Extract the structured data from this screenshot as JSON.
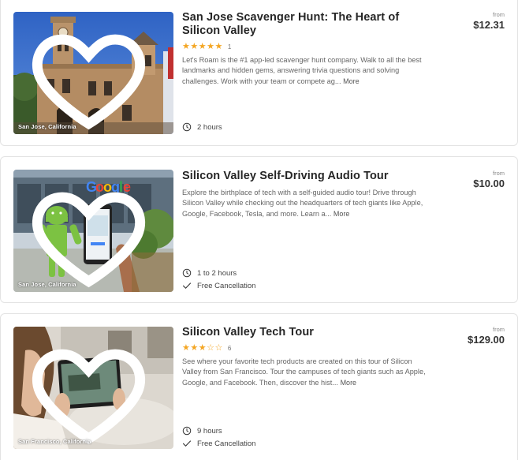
{
  "tours": [
    {
      "title": "San Jose Scavenger Hunt: The Heart of Silicon Valley",
      "location": "San Jose, California",
      "rating": 5,
      "review_count": "1",
      "description": "Let's Roam is the #1 app-led scavenger hunt company. Walk to all the best landmarks and hidden gems, answering trivia questions and solving challenges. Work with your team or compete ag...",
      "more_label": "More",
      "duration": "2 hours",
      "cancellation": "",
      "price_from": "from",
      "price": "$12.31"
    },
    {
      "title": "Silicon Valley Self-Driving Audio Tour",
      "location": "San Jose, California",
      "description": "Explore the birthplace of tech with a self-guided audio tour! Drive through Silicon Valley while checking out the headquarters of tech giants like Apple, Google, Facebook, Tesla, and more. Learn a...",
      "more_label": "More",
      "duration": "1 to 2 hours",
      "cancellation": "Free Cancellation",
      "price_from": "from",
      "price": "$10.00"
    },
    {
      "title": "Silicon Valley Tech Tour",
      "location": "San Francisco, California",
      "rating": 3,
      "review_count": "6",
      "description": "See where your favorite tech products are created on this tour of Silicon Valley from San Francisco. Tour the campuses of tech giants such as Apple, Google, and Facebook. Then, discover the hist...",
      "more_label": "More",
      "duration": "9 hours",
      "cancellation": "Free Cancellation",
      "price_from": "from",
      "price": "$129.00"
    }
  ],
  "icons": {
    "favorite": "heart-icon",
    "duration": "clock-icon",
    "cancellation": "check-icon",
    "rating": "star-icon"
  },
  "colors": {
    "star": "#f4a623",
    "title": "#262626",
    "description": "#666666"
  }
}
